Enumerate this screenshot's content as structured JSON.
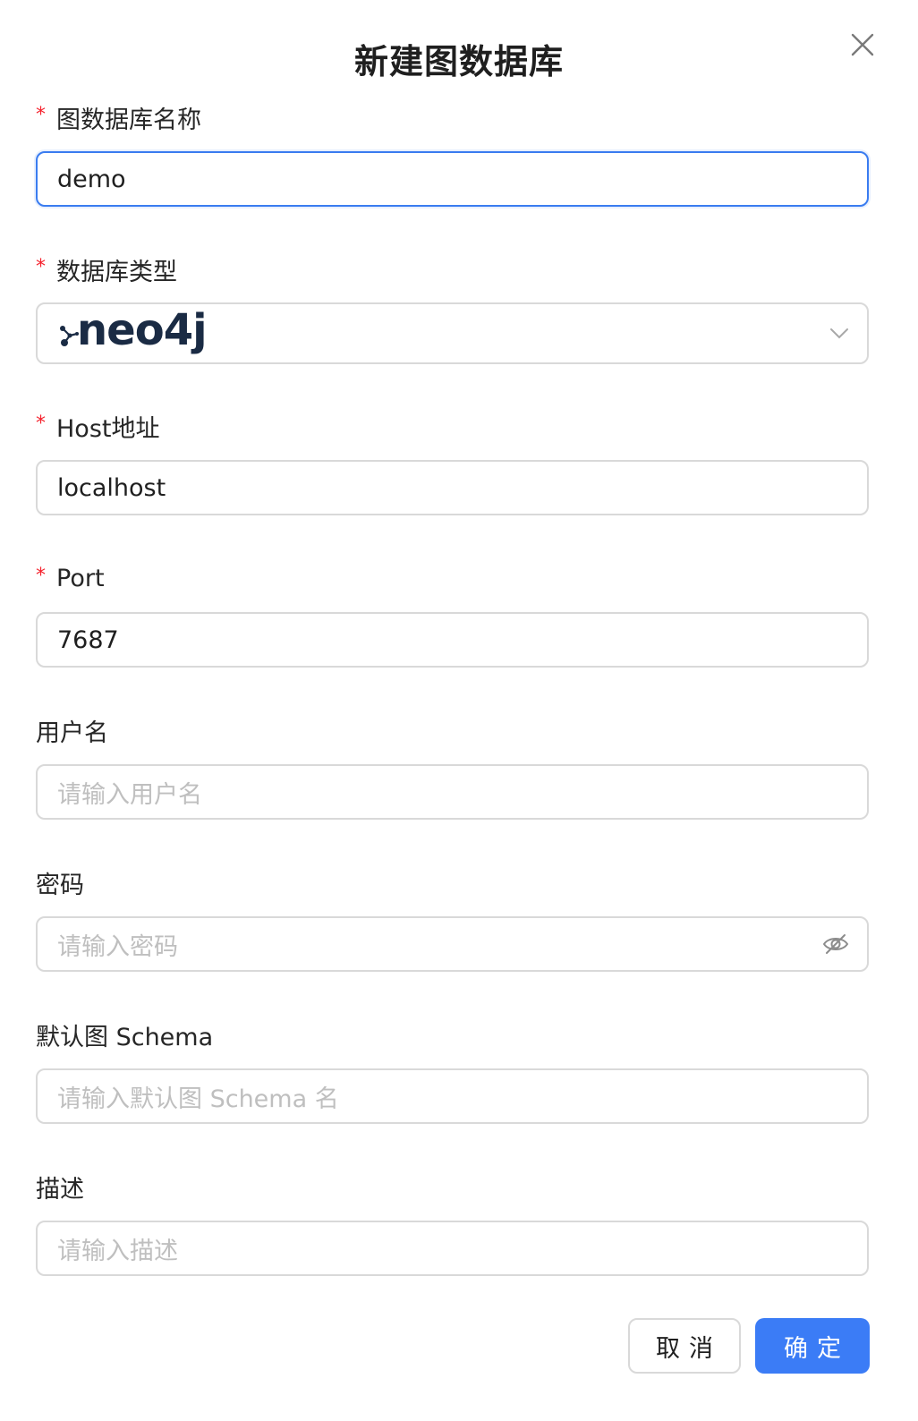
{
  "dialog": {
    "title": "新建图数据库",
    "close_label": "×"
  },
  "fields": {
    "name": {
      "label": "图数据库名称",
      "required": true,
      "value": "demo"
    },
    "db_type": {
      "label": "数据库类型",
      "required": true,
      "selected": "neo4j"
    },
    "host": {
      "label": "Host地址",
      "required": true,
      "value": "localhost"
    },
    "port": {
      "label": "Port",
      "required": true,
      "value": "7687"
    },
    "username": {
      "label": "用户名",
      "placeholder": "请输入用户名"
    },
    "password": {
      "label": "密码",
      "placeholder": "请输入密码"
    },
    "schema": {
      "label": "默认图 Schema",
      "placeholder": "请输入默认图 Schema 名"
    },
    "description": {
      "label": "描述",
      "placeholder": "请输入描述"
    }
  },
  "buttons": {
    "cancel": "取消",
    "confirm": "确定"
  },
  "colors": {
    "primary": "#3b7cf6",
    "required": "#f5222d",
    "border": "#d9d9d9",
    "placeholder": "#bfbfbf",
    "neo4j_text": "#1a2b44"
  },
  "icons": {
    "close": "close-icon",
    "chevron": "chevron-down-icon",
    "eye": "eye-invisible-icon",
    "logo": "neo4j-logo"
  }
}
